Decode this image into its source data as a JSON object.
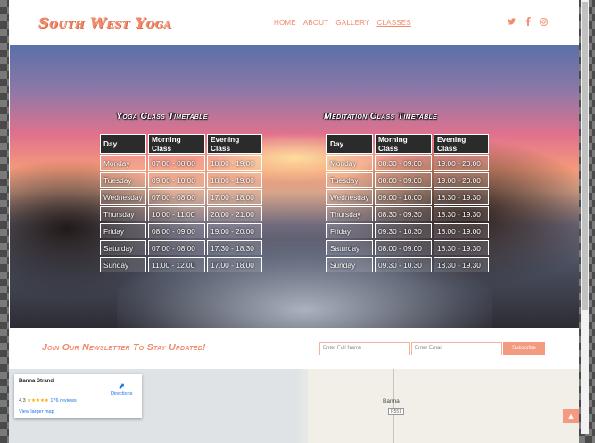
{
  "brand": {
    "logo": "South West Yoga",
    "accent": "#f08a6a"
  },
  "nav": {
    "items": [
      "HOME",
      "ABOUT",
      "GALLERY",
      "CLASSES"
    ],
    "active": "CLASSES"
  },
  "social": [
    "twitter-icon",
    "facebook-icon",
    "instagram-icon"
  ],
  "yoga": {
    "title": "Yoga Class Timetable",
    "headers": [
      "Day",
      "Morning Class",
      "Evening Class"
    ],
    "rows": [
      [
        "Monday",
        "07.00 - 08.00",
        "18.00 - 19.00"
      ],
      [
        "Tuesday",
        "09.00 - 10.00",
        "18.00 - 19.00"
      ],
      [
        "Wednesday",
        "07.00 - 08.00",
        "17.00 - 18.00"
      ],
      [
        "Thursday",
        "10.00 - 11.00",
        "20.00 - 21.00"
      ],
      [
        "Friday",
        "08.00 - 09.00",
        "19.00 - 20.00"
      ],
      [
        "Saturday",
        "07.00 - 08.00",
        "17.30 - 18.30"
      ],
      [
        "Sunday",
        "11.00 - 12.00",
        "17.00 - 18.00"
      ]
    ]
  },
  "meditation": {
    "title": "Meditation Class Timetable",
    "headers": [
      "Day",
      "Morning Class",
      "Evening Class"
    ],
    "rows": [
      [
        "Monday",
        "08.30 - 09.00",
        "19.00 - 20.00"
      ],
      [
        "Tuesday",
        "08.00 - 09.00",
        "19.00 - 20.00"
      ],
      [
        "Wednesday",
        "09.00 - 10.00",
        "18.30 - 19.30"
      ],
      [
        "Thursday",
        "08.30 - 09.30",
        "18.30 - 19.30"
      ],
      [
        "Friday",
        "09.30 - 10.30",
        "18.00 - 19.00"
      ],
      [
        "Saturday",
        "08.00 - 09.00",
        "18.30 - 19.30"
      ],
      [
        "Sunday",
        "09.30 - 10.30",
        "18.30 - 19.30"
      ]
    ]
  },
  "newsletter": {
    "title": "Join Our Newsletter To Stay Updated!",
    "name_placeholder": "Enter Full Name",
    "email_placeholder": "Enter Email",
    "button": "Subscribe"
  },
  "map": {
    "place": "Banna Strand",
    "rating_value": "4.3",
    "stars": "★★★★★",
    "reviews": "176 reviews",
    "directions": "Directions",
    "larger_map": "View larger map",
    "town_label": "Banna",
    "road_label": "R551"
  }
}
